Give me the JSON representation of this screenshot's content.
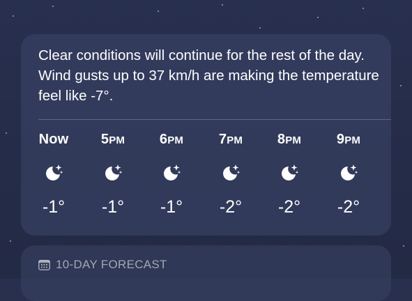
{
  "summary": {
    "text": "Clear conditions will continue for the rest of the day. Wind gusts up to 37 km/h are making the temperature feel like -7°."
  },
  "hourly": [
    {
      "hour": "Now",
      "suffix": "",
      "icon": "moon-stars-icon",
      "temp": "-1°"
    },
    {
      "hour": "5",
      "suffix": "PM",
      "icon": "moon-stars-icon",
      "temp": "-1°"
    },
    {
      "hour": "6",
      "suffix": "PM",
      "icon": "moon-stars-icon",
      "temp": "-1°"
    },
    {
      "hour": "7",
      "suffix": "PM",
      "icon": "moon-stars-icon",
      "temp": "-2°"
    },
    {
      "hour": "8",
      "suffix": "PM",
      "icon": "moon-stars-icon",
      "temp": "-2°"
    },
    {
      "hour": "9",
      "suffix": "PM",
      "icon": "moon-stars-icon",
      "temp": "-2°"
    }
  ],
  "forecast": {
    "title": "10-DAY FORECAST",
    "icon": "calendar-icon"
  },
  "colors": {
    "background": "#28304f",
    "card": "#3a4365"
  }
}
